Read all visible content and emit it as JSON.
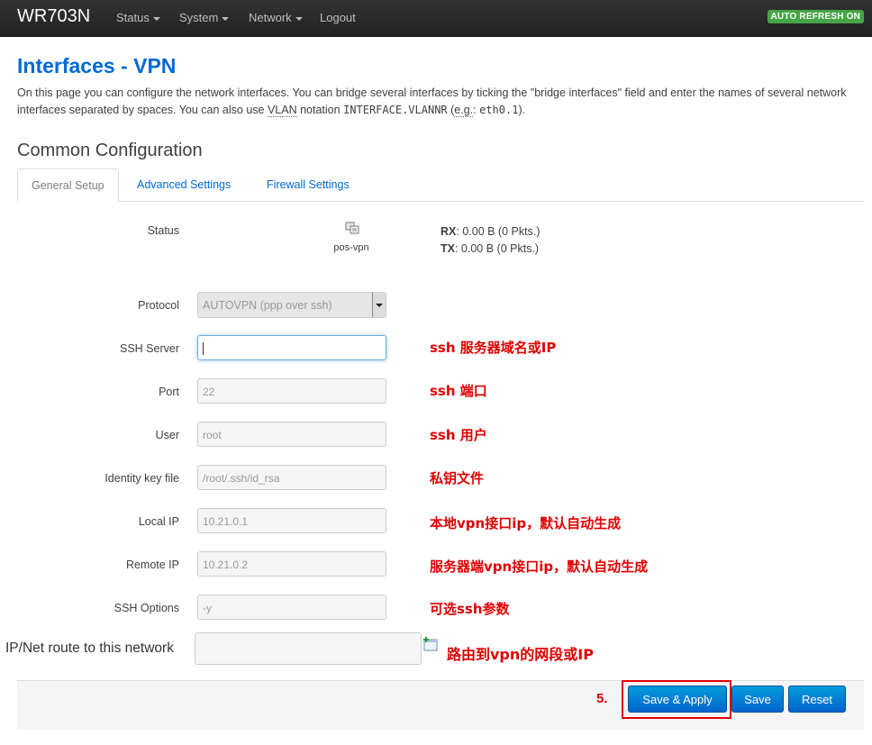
{
  "navbar": {
    "brand": "WR703N",
    "items": [
      "Status",
      "System",
      "Network",
      "Logout"
    ],
    "badge": "AUTO REFRESH ON"
  },
  "page": {
    "title": "Interfaces - VPN",
    "desc_1": "On this page you can configure the network interfaces. You can bridge several interfaces by ticking the \"bridge interfaces\" field and enter the names of several network interfaces separated by spaces. You can also use ",
    "desc_vlan": "VLAN",
    "desc_2": " notation ",
    "desc_code1": "INTERFACE.VLANNR",
    "desc_3": " (",
    "desc_eg": "e.g.",
    "desc_4": ": ",
    "desc_code2": "eth0.1",
    "desc_5": ")."
  },
  "section": {
    "title": "Common Configuration",
    "tabs": [
      "General Setup",
      "Advanced Settings",
      "Firewall Settings"
    ]
  },
  "status": {
    "label": "Status",
    "iface": "pos-vpn",
    "rx_label": "RX",
    "rx_value": ": 0.00 B (0 Pkts.)",
    "tx_label": "TX",
    "tx_value": ": 0.00 B (0 Pkts.)"
  },
  "form": {
    "protocol": {
      "label": "Protocol",
      "value": "AUTOVPN (ppp over ssh)"
    },
    "ssh_server": {
      "label": "SSH Server",
      "value": ""
    },
    "port": {
      "label": "Port",
      "value": "22"
    },
    "user": {
      "label": "User",
      "value": "root"
    },
    "identity": {
      "label": "Identity key file",
      "value": "/root/.ssh/id_rsa"
    },
    "local_ip": {
      "label": "Local IP",
      "value": "10.21.0.1"
    },
    "remote_ip": {
      "label": "Remote IP",
      "value": "10.21.0.2"
    },
    "ssh_options": {
      "label": "SSH Options",
      "value": "-y"
    },
    "route": {
      "label": "IP/Net route to this network",
      "value": ""
    }
  },
  "annotations": {
    "ssh_server": "ssh 服务器域名或IP",
    "port": "ssh 端口",
    "user": "ssh 用户",
    "identity": "私钥文件",
    "local_ip": "本地vpn接口ip，默认自动生成",
    "remote_ip": "服务器端vpn接口ip，默认自动生成",
    "ssh_options": "可选ssh参数",
    "route": "路由到vpn的网段或IP",
    "step": "5."
  },
  "actions": {
    "save_apply": "Save & Apply",
    "save": "Save",
    "reset": "Reset"
  },
  "colors": {
    "accent": "#0069d6",
    "annotation": "#e00000",
    "badge": "#46a546"
  }
}
